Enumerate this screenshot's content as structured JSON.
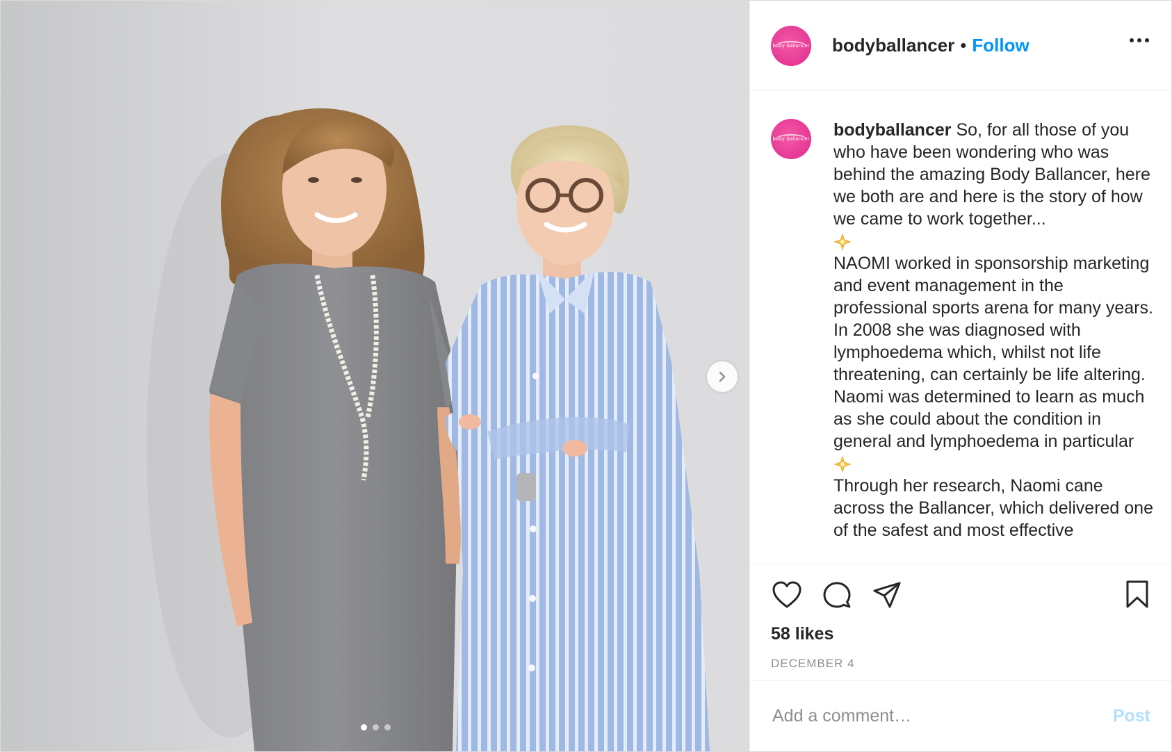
{
  "post": {
    "username": "bodyballancer",
    "separator": "•",
    "follow_label": "Follow",
    "avatar_text": "body ballancer",
    "more_icon": "more-horizontal-icon",
    "caption": {
      "username": "bodyballancer",
      "intro": "So, for all those of you who have been wondering who was behind the amazing Body Ballancer, here we both are and here is the story of how we came to work together...",
      "paragraph_1": "NAOMI worked in sponsorship marketing and event management in the professional sports arena for many years. In 2008 she was diagnosed with lymphoedema which, whilst not life threatening, can certainly be life altering. Naomi was determined to learn as much as she could about the condition in general and lymphoedema in particular",
      "paragraph_2": "Through her research, Naomi cane across the Ballancer, which delivered one of the safest and most effective"
    },
    "likes": "58 likes",
    "date": "DECEMBER 4",
    "comment_placeholder": "Add a comment…",
    "post_label": "Post",
    "carousel": {
      "slide_count": 3,
      "active_slide": 1
    }
  },
  "colors": {
    "accent": "#0095f6",
    "post_disabled": "#b2dffc",
    "brand_pink": "#e63894",
    "text": "#262626",
    "muted": "#8e8e8e"
  }
}
